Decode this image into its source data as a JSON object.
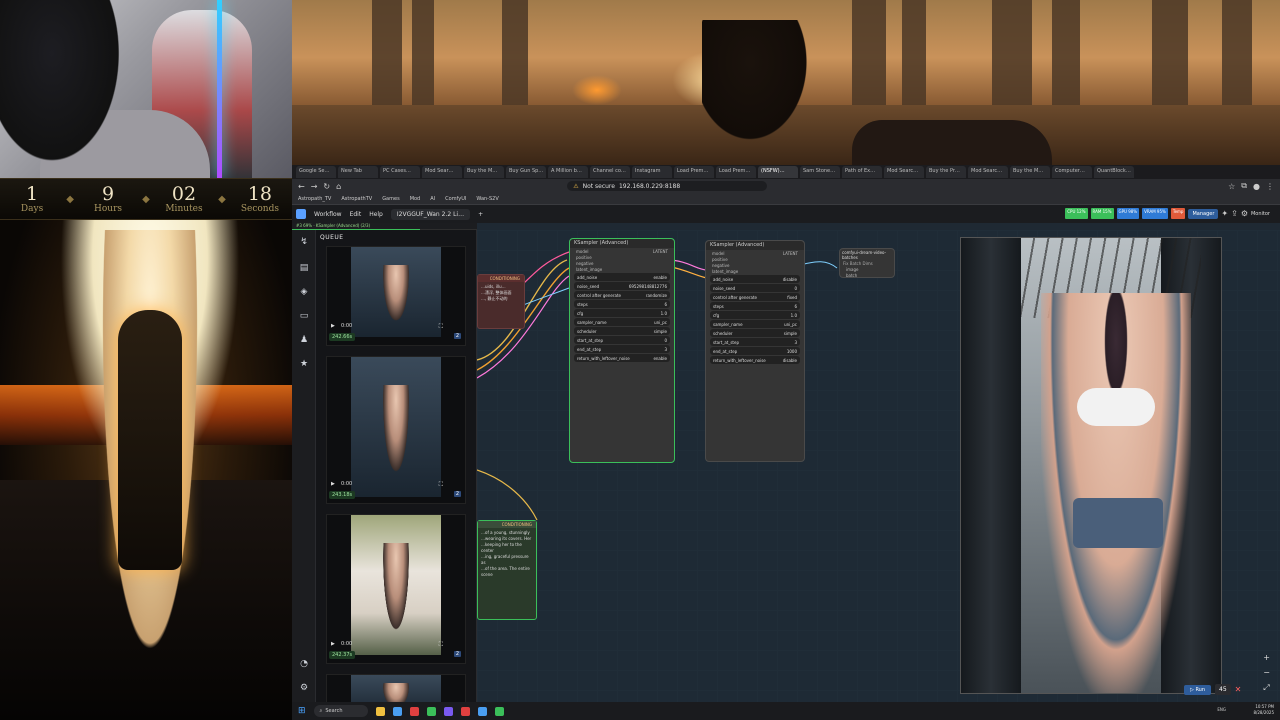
{
  "countdown": {
    "days": "1",
    "days_label": "Days",
    "hours": "9",
    "hours_label": "Hours",
    "minutes": "02",
    "minutes_label": "Minutes",
    "seconds": "18",
    "seconds_label": "Seconds"
  },
  "browser": {
    "tabs": [
      "Google Se…",
      "New Tab",
      "PC Cases…",
      "Mod Sear…",
      "Buy the M…",
      "Buy Gun Sp…",
      "A Million b…",
      "Channel co…",
      "Instagram",
      "Load Prem…",
      "Load Prem…",
      "(NSFW)…",
      "Sam Stone…",
      "Path of Ex…",
      "Mod Searc…",
      "Buy the Pr…",
      "Mod Searc…",
      "Buy the M…",
      "Computer…",
      "QuantBlock…"
    ],
    "active_tab_index": 11,
    "url_security": "Not secure",
    "url": "192.168.0.229:8188",
    "bookmarks": [
      "Astropath_TV",
      "AstropathTV",
      "Games",
      "Mod",
      "AI",
      "ComfyUI",
      "Wan-S2V"
    ]
  },
  "comfy": {
    "menu": [
      "Workflow",
      "Edit",
      "Help"
    ],
    "workflow_tab": "I2VGGUF_Wan 2.2 Li…",
    "manager_label": "Manager",
    "monitor_label": "Monitor",
    "stats": [
      {
        "label": "CPU 12%",
        "color": "#3bbf5a"
      },
      {
        "label": "RAM 15%",
        "color": "#3bbf5a"
      },
      {
        "label": "GPU 98%",
        "color": "#2f7bd6"
      },
      {
        "label": "VRAM 95%",
        "color": "#2f7bd6"
      },
      {
        "label": "Temp",
        "color": "#e05a3a"
      }
    ],
    "run_status": "#3 69% · KSampler (Advanced) (2/3)",
    "run_progress": 0.69,
    "queue_title": "QUEUE",
    "queue_items": [
      {
        "time_label": "0:00",
        "duration": "242.66s",
        "count": "2"
      },
      {
        "time_label": "0:00",
        "duration": "243.18s",
        "count": "2"
      },
      {
        "time_label": "0:00",
        "duration": "242.37s",
        "count": "2"
      }
    ],
    "nodes": {
      "ksampler1": {
        "title": "KSampler (Advanced)",
        "inputs": [
          "model",
          "positive",
          "negative",
          "latent_image"
        ],
        "output": "LATENT",
        "widgets": [
          {
            "name": "add_noise",
            "value": "enable"
          },
          {
            "name": "noise_seed",
            "value": "695298148812776"
          },
          {
            "name": "control after generate",
            "value": "randomize"
          },
          {
            "name": "steps",
            "value": "6"
          },
          {
            "name": "cfg",
            "value": "1.0"
          },
          {
            "name": "sampler_name",
            "value": "uni_pc"
          },
          {
            "name": "scheduler",
            "value": "simple"
          },
          {
            "name": "start_at_step",
            "value": "0"
          },
          {
            "name": "end_at_step",
            "value": "3"
          },
          {
            "name": "return_with_leftover_noise",
            "value": "enable"
          }
        ]
      },
      "ksampler2": {
        "title": "KSampler (Advanced)",
        "inputs": [
          "model",
          "positive",
          "negative",
          "latent_image"
        ],
        "output": "LATENT",
        "widgets": [
          {
            "name": "add_noise",
            "value": "disable"
          },
          {
            "name": "noise_seed",
            "value": "0"
          },
          {
            "name": "control after generate",
            "value": "fixed"
          },
          {
            "name": "steps",
            "value": "6"
          },
          {
            "name": "cfg",
            "value": "1.0"
          },
          {
            "name": "sampler_name",
            "value": "uni_pc"
          },
          {
            "name": "scheduler",
            "value": "simple"
          },
          {
            "name": "start_at_step",
            "value": "3"
          },
          {
            "name": "end_at_step",
            "value": "1000"
          },
          {
            "name": "return_with_leftover_noise",
            "value": "disable"
          }
        ]
      },
      "batch_node": {
        "title": "comfyui-dream-video-batches",
        "subtitle": "Fix Batch Dims",
        "ports": [
          "image",
          "batch"
        ]
      },
      "cond1": {
        "title": "CONDITIONING",
        "lines": [
          "…uids, illu…",
          "…漂浮, 整体画面",
          "…, 静止不动的",
          "…"
        ]
      },
      "cond2": {
        "title": "CONDITIONING",
        "lines": [
          "…of a young, stunningly",
          "…wearing its covers. Her",
          "…keeping her to the center",
          "…ing, graceful pressure as",
          "…of the area. The entire scene"
        ]
      }
    },
    "run_button": "Run",
    "run_count": "45"
  },
  "taskbar": {
    "search_placeholder": "Search",
    "time": "10:57 PM",
    "date": "8/28/2025",
    "lang": "ENG"
  }
}
